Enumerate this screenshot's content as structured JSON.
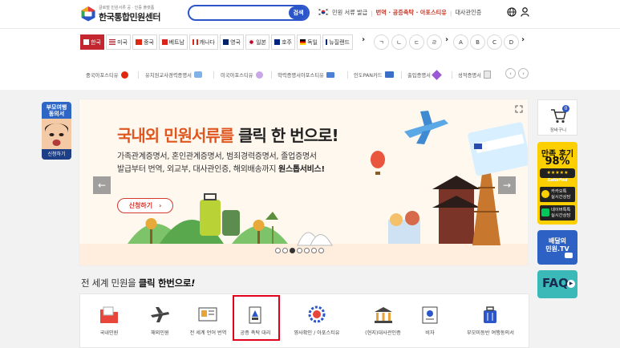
{
  "header": {
    "logo_subtitle": "글로벌 민원서류 공 · 인증 플랫폼",
    "logo_title": "한국통합민원센터",
    "search": {
      "value": "",
      "button_label": "검색"
    },
    "top_links": [
      "민원 서류 발급",
      "번역 · 공증촉탁 · 아포스티유",
      "대사관인증"
    ]
  },
  "country_tabs": [
    {
      "label": "한국",
      "active": true
    },
    {
      "label": "미국",
      "active": false
    },
    {
      "label": "중국",
      "active": false
    },
    {
      "label": "베트남",
      "active": false
    },
    {
      "label": "캐나다",
      "active": false
    },
    {
      "label": "영국",
      "active": false
    },
    {
      "label": "일본",
      "active": false
    },
    {
      "label": "호주",
      "active": false
    },
    {
      "label": "독일",
      "active": false
    },
    {
      "label": "뉴질랜드",
      "active": false
    }
  ],
  "letter_filters": [
    "ㄱ",
    "ㄴ",
    "ㄷ",
    "ㄹ",
    "A",
    "B",
    "C",
    "D"
  ],
  "quick_links": [
    "중국아포스티유",
    "유치원교사경력증명서",
    "미국아포스티유",
    "학력증명서아포스티유",
    "인도PAN카드",
    "출입증명서",
    "성적증명서"
  ],
  "banner": {
    "headline_part1": "국내외 민원서류를",
    "headline_part2": "클릭 한 번으로!",
    "line1": "가족관계증명서, 혼인관계증명서, 범죄경력증명서, 졸업증명서",
    "line2_prefix": "발급부터 번역, 외교부, 대사관인증, 해외배송까지",
    "line2_bold": "원스톱서비스!",
    "apply_button": "신청하기",
    "prev_arrow": "←",
    "next_arrow": "→",
    "slide_count": 7,
    "active_slide_index": 2
  },
  "left_badge": {
    "line1": "부모여행",
    "line2": "동의서",
    "button": "신청하기"
  },
  "right_side": {
    "cart_label": "장바구니",
    "cart_count": "0",
    "review_title": "만족 후기",
    "review_pct": "98%",
    "review_sat": "Satisfied",
    "kakao_label1": "카카오톡",
    "kakao_label2": "실시간상담",
    "naver_label1": "네이버톡톡",
    "naver_label2": "실시간상담",
    "tv_line1": "배달의",
    "tv_line2": "민원.TV",
    "faq": "FAQ"
  },
  "section": {
    "title_prefix": "전 세계 민원을",
    "title_bold": "클릭 한번으로",
    "title_suffix": "!"
  },
  "services": [
    "국내민원",
    "해외민원",
    "전 세계 언어 번역",
    "공증 촉탁 대리",
    "영사확인 / 아포스티유",
    "(현지)대사관인증",
    "비자",
    "부모미동반 여행동의서"
  ],
  "colors": {
    "brand_blue": "#2b56c9",
    "accent_red": "#c3262f",
    "highlight_red": "#e0001b"
  }
}
